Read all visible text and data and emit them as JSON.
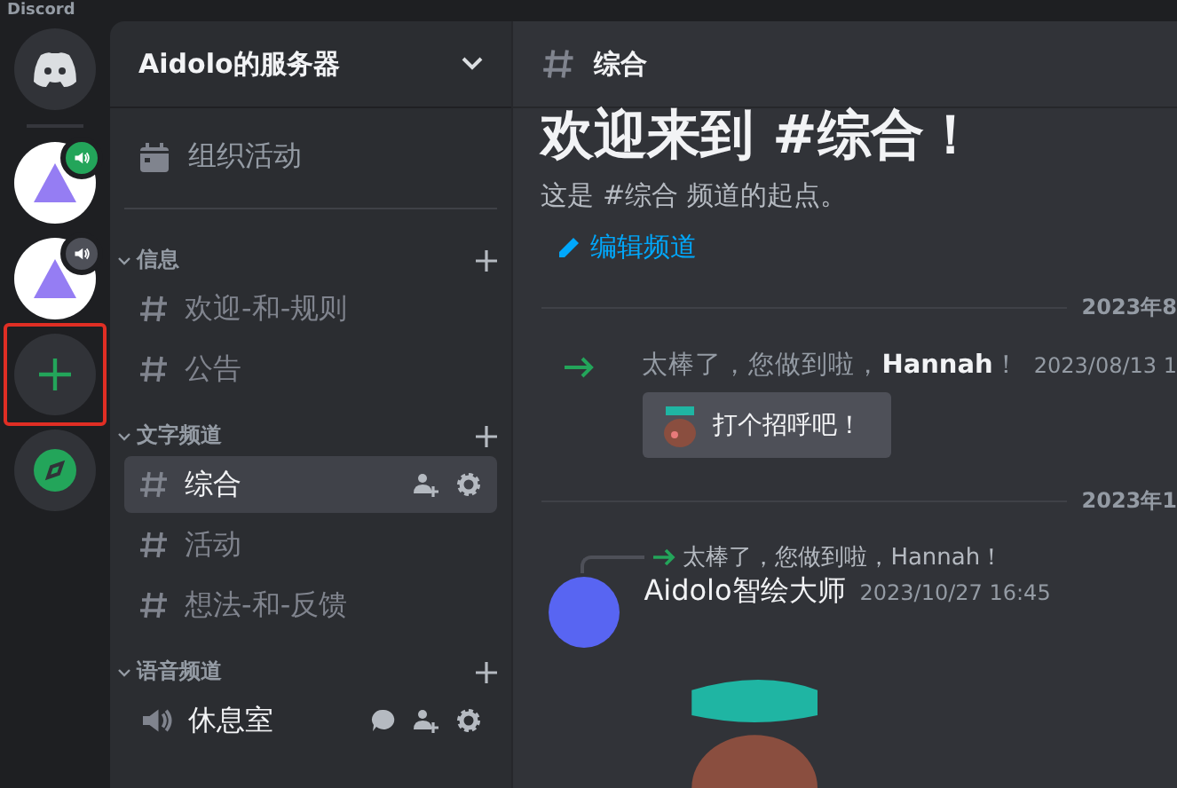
{
  "window": {
    "title": "Discord"
  },
  "servers": [
    {
      "kind": "home"
    },
    {
      "kind": "server",
      "speaking": true
    },
    {
      "kind": "server",
      "speaking": false
    },
    {
      "kind": "add",
      "annotated": true
    },
    {
      "kind": "explore"
    }
  ],
  "sidebar": {
    "server_name": "Aidolo的服务器",
    "events_label": "组织活动",
    "categories": [
      {
        "name": "信息",
        "expanded": true,
        "channels": [
          {
            "kind": "text",
            "name": "欢迎-和-规则",
            "selected": false,
            "active": false
          },
          {
            "kind": "text",
            "name": "公告",
            "selected": false,
            "active": false
          }
        ]
      },
      {
        "name": "文字频道",
        "expanded": true,
        "channels": [
          {
            "kind": "text",
            "name": "综合",
            "selected": true,
            "active": true
          },
          {
            "kind": "text",
            "name": "活动",
            "selected": false,
            "active": false
          },
          {
            "kind": "text",
            "name": "想法-和-反馈",
            "selected": false,
            "active": false
          }
        ]
      },
      {
        "name": "语音频道",
        "expanded": true,
        "channels": [
          {
            "kind": "voice",
            "name": "休息室",
            "selected": false,
            "active": true
          }
        ]
      }
    ]
  },
  "header": {
    "channel": "综合"
  },
  "welcome": {
    "title": "欢迎来到 #综合！",
    "subtitle": "这是 #综合 频道的起点。",
    "edit_link": "编辑频道"
  },
  "messages": [
    {
      "kind": "divider",
      "label": "2023年8"
    },
    {
      "kind": "join",
      "text": "太棒了，您做到啦，**Hannah**！",
      "time": "2023/08/13 1",
      "button": "打个招呼吧！"
    },
    {
      "kind": "divider",
      "label": "2023年1"
    },
    {
      "kind": "reply",
      "reply_text": "太棒了，您做到啦，Hannah！",
      "author": "Aidolo智绘大师",
      "time": "2023/10/27 16:45"
    }
  ]
}
